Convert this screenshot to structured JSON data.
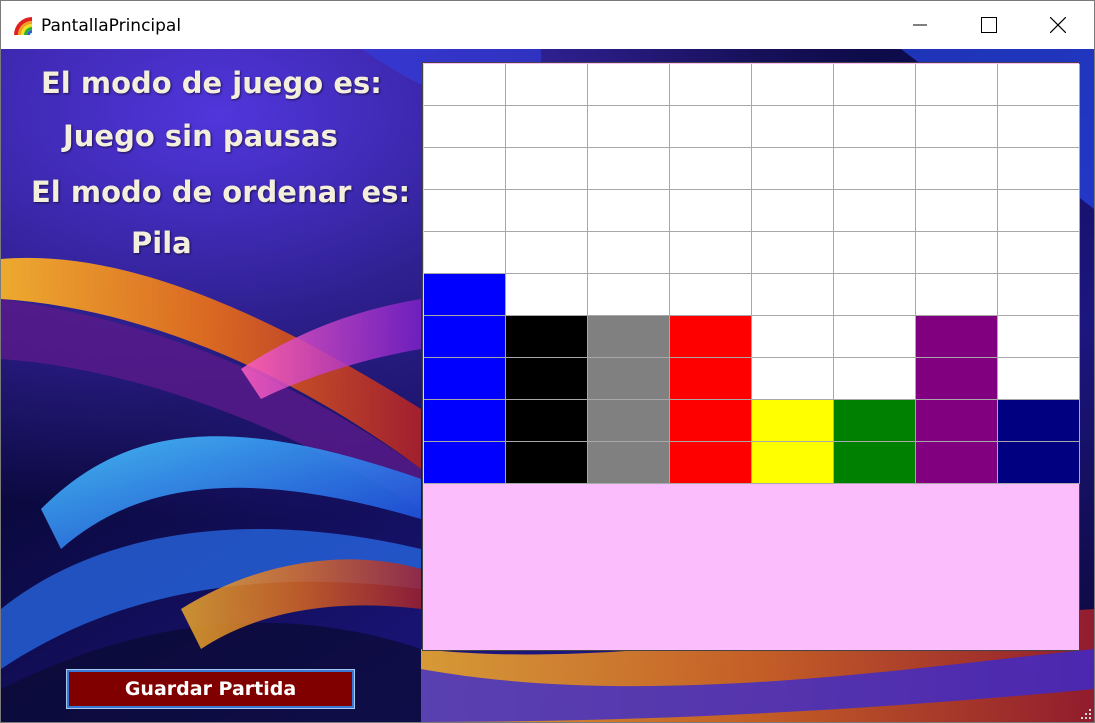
{
  "window": {
    "title": "PantallaPrincipal",
    "app_icon": "rainbow-icon",
    "controls": {
      "minimize_icon": "minimize-icon",
      "maximize_icon": "maximize-icon",
      "close_icon": "close-icon"
    }
  },
  "info": {
    "mode_label": "El modo de juego es:",
    "mode_value": "Juego sin pausas",
    "order_label": "El modo de ordenar es:",
    "order_value": "Pila"
  },
  "board": {
    "columns": 8,
    "rows": 10,
    "background_color": "#fbbdfc",
    "colors": {
      "white": "#ffffff",
      "blue": "#0000ff",
      "black": "#000000",
      "gray": "#808080",
      "red": "#ff0000",
      "yellow": "#ffff00",
      "green": "#008000",
      "purple": "#800080",
      "navy": "#000080"
    },
    "cells": [
      [
        "white",
        "white",
        "white",
        "white",
        "white",
        "white",
        "white",
        "white"
      ],
      [
        "white",
        "white",
        "white",
        "white",
        "white",
        "white",
        "white",
        "white"
      ],
      [
        "white",
        "white",
        "white",
        "white",
        "white",
        "white",
        "white",
        "white"
      ],
      [
        "white",
        "white",
        "white",
        "white",
        "white",
        "white",
        "white",
        "white"
      ],
      [
        "white",
        "white",
        "white",
        "white",
        "white",
        "white",
        "white",
        "white"
      ],
      [
        "blue",
        "white",
        "white",
        "white",
        "white",
        "white",
        "white",
        "white"
      ],
      [
        "blue",
        "black",
        "gray",
        "red",
        "white",
        "white",
        "purple",
        "white"
      ],
      [
        "blue",
        "black",
        "gray",
        "red",
        "white",
        "white",
        "purple",
        "white"
      ],
      [
        "blue",
        "black",
        "gray",
        "red",
        "yellow",
        "green",
        "purple",
        "navy"
      ],
      [
        "blue",
        "black",
        "gray",
        "red",
        "yellow",
        "green",
        "purple",
        "navy"
      ]
    ]
  },
  "actions": {
    "save_label": "Guardar Partida",
    "save_color": "#800000"
  }
}
